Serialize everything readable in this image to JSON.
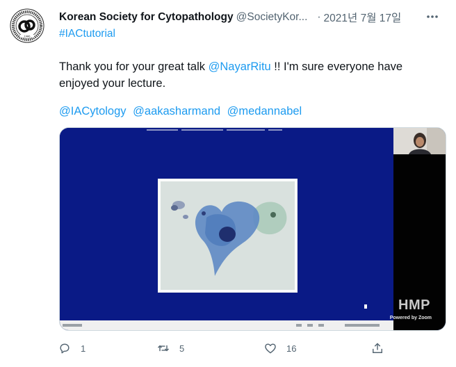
{
  "author": {
    "name": "Korean Society for Cytopathology",
    "handle": "@SocietyKor...",
    "avatar_ring_text": "THE KOREAN SOCIETY FOR CYTOPATHOLOGY",
    "avatar_year": "1986"
  },
  "date": "2021년 7월 17일",
  "separator": "·",
  "hashtag_line": "#IACtutorial",
  "body": {
    "prefix": "Thank you for your great talk ",
    "mention": "@NayarRitu",
    "suffix": " !! I'm sure everyone have enjoyed your lecture."
  },
  "mentions": [
    "@IACytology",
    "@aakasharmand",
    "@medannabel"
  ],
  "media": {
    "watermark": "HMP",
    "watermark_sub": "Powered by Zoom",
    "colors": {
      "slide_bg": "#0a1a86",
      "side_panel": "#020202"
    }
  },
  "actions": {
    "reply_count": "1",
    "retweet_count": "5",
    "like_count": "16"
  },
  "icons": {
    "more": "more-horizontal-icon",
    "reply": "reply-icon",
    "retweet": "retweet-icon",
    "like": "heart-icon",
    "share": "share-icon"
  },
  "colors": {
    "link": "#1d9bf0",
    "muted": "#536471",
    "text": "#0f1419"
  }
}
